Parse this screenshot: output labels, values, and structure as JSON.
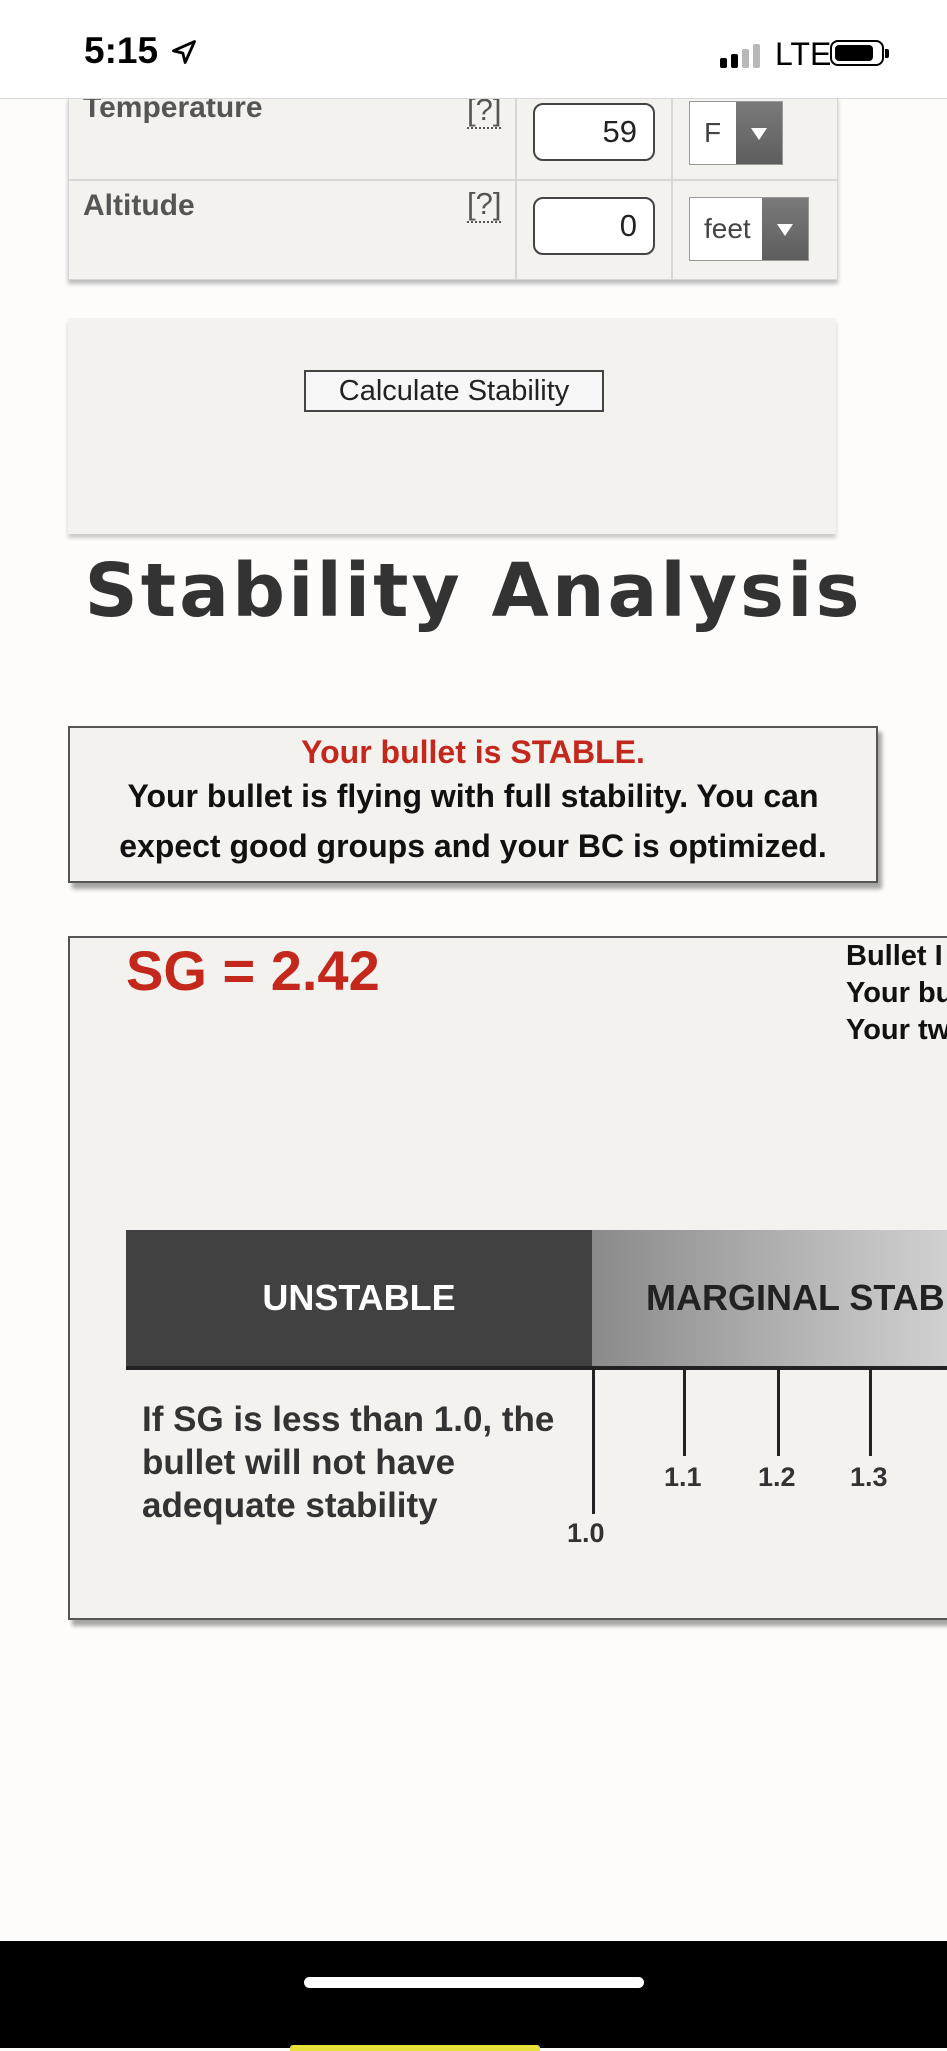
{
  "status_bar": {
    "time": "5:15",
    "network": "LTE"
  },
  "form": {
    "rows": [
      {
        "label": "Temperature",
        "help": "[?]",
        "value": "59",
        "unit": "F"
      },
      {
        "label": "Altitude",
        "help": "[?]",
        "value": "0",
        "unit": "feet"
      }
    ]
  },
  "calculate": {
    "button_label": "Calculate Stability"
  },
  "analysis": {
    "heading": "Stability Analysis",
    "result_title": "Your bullet is STABLE.",
    "result_line1": "Your bullet is flying with full stability. You can",
    "result_line2": "expect good groups and your BC is optimized."
  },
  "sg": {
    "value_text": "SG = 2.42",
    "info_lines": [
      "Bullet I",
      "Your bu",
      "Your tw"
    ],
    "bar_unstable": "UNSTABLE",
    "bar_marginal": "MARGINAL STABIL",
    "unstable_note": [
      "If SG is less than 1.0, the",
      "bullet will not have",
      "adequate stability"
    ],
    "ticks": [
      "1.0",
      "1.1",
      "1.2",
      "1.3"
    ]
  },
  "colors": {
    "accent_red": "#c4281c",
    "panel_bg": "#f3f2ef",
    "unstable_bar": "#414141"
  }
}
